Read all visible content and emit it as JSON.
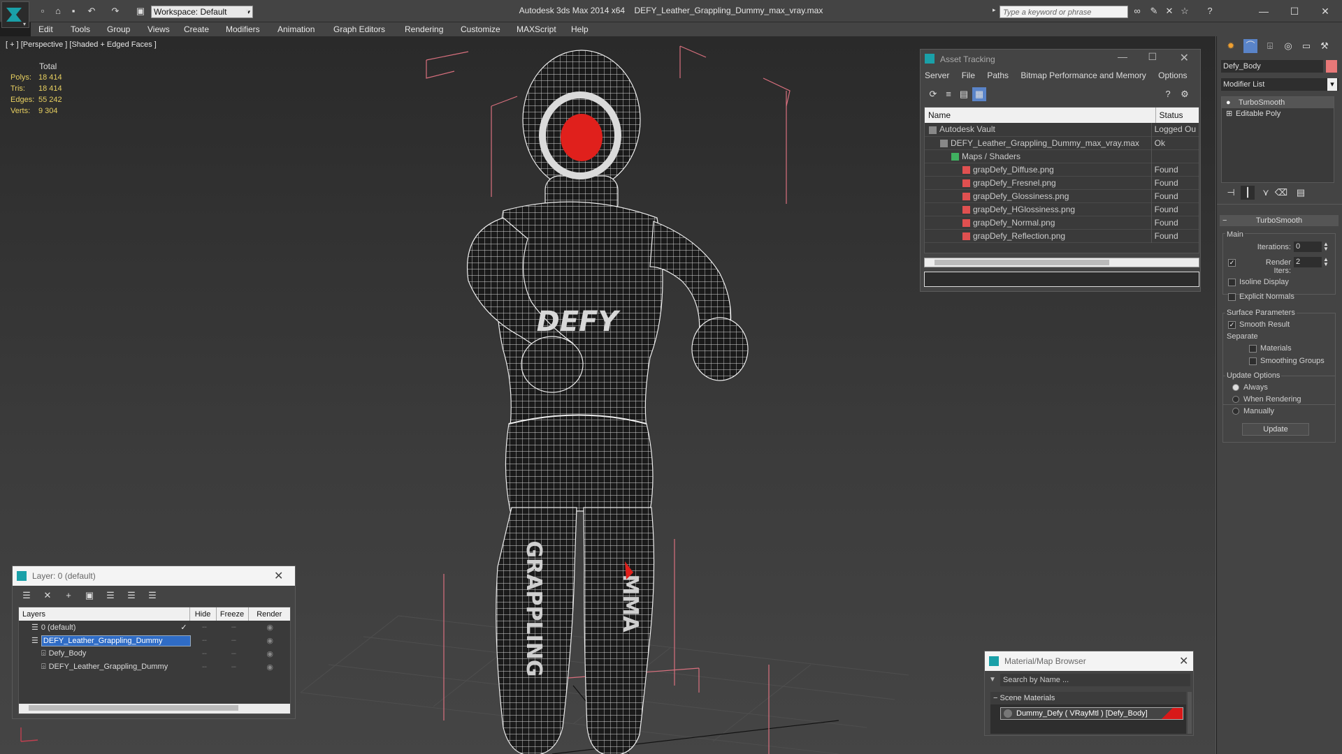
{
  "titlebar": {
    "workspace": "Workspace: Default",
    "app_title": "Autodesk 3ds Max  2014 x64",
    "file_title": "DEFY_Leather_Grappling_Dummy_max_vray.max",
    "search_placeholder": "Type a keyword or phrase"
  },
  "menu": [
    "Edit",
    "Tools",
    "Group",
    "Views",
    "Create",
    "Modifiers",
    "Animation",
    "Graph Editors",
    "Rendering",
    "Customize",
    "MAXScript",
    "Help"
  ],
  "viewport": {
    "label": "[ + ] [Perspective ] [Shaded + Edged Faces ]",
    "stats_header": "Total",
    "stats": [
      {
        "label": "Polys:",
        "value": "18 414"
      },
      {
        "label": "Tris:",
        "value": "18 414"
      },
      {
        "label": "Edges:",
        "value": "55 242"
      },
      {
        "label": "Verts:",
        "value": "9 304"
      }
    ],
    "chest_logo": "DEFY",
    "leg_text_left": "GRAPPLING",
    "leg_text_right": "MMA"
  },
  "asset_tracking": {
    "title": "Asset Tracking",
    "menu": [
      "Server",
      "File",
      "Paths",
      "Bitmap Performance and Memory",
      "Options"
    ],
    "col_name": "Name",
    "col_status": "Status",
    "rows": [
      {
        "name": "Autodesk Vault",
        "status": "Logged Ou",
        "indent": 0,
        "icon": "vault-icon"
      },
      {
        "name": "DEFY_Leather_Grappling_Dummy_max_vray.max",
        "status": "Ok",
        "indent": 1,
        "icon": "max-file-icon"
      },
      {
        "name": "Maps / Shaders",
        "status": "",
        "indent": 2,
        "icon": "maps-icon"
      },
      {
        "name": "grapDefy_Diffuse.png",
        "status": "Found",
        "indent": 3,
        "icon": "png-icon"
      },
      {
        "name": "grapDefy_Fresnel.png",
        "status": "Found",
        "indent": 3,
        "icon": "png-icon"
      },
      {
        "name": "grapDefy_Glossiness.png",
        "status": "Found",
        "indent": 3,
        "icon": "png-icon"
      },
      {
        "name": "grapDefy_HGlossiness.png",
        "status": "Found",
        "indent": 3,
        "icon": "png-icon"
      },
      {
        "name": "grapDefy_Normal.png",
        "status": "Found",
        "indent": 3,
        "icon": "png-icon"
      },
      {
        "name": "grapDefy_Reflection.png",
        "status": "Found",
        "indent": 3,
        "icon": "png-icon"
      }
    ]
  },
  "layer_panel": {
    "title": "Layer: 0 (default)",
    "help": "?",
    "col_layers": "Layers",
    "col_hide": "Hide",
    "col_freeze": "Freeze",
    "col_render": "Render",
    "rows": [
      {
        "name": "0 (default)",
        "indent": 1,
        "selected": false,
        "active": true
      },
      {
        "name": "DEFY_Leather_Grappling_Dummy",
        "indent": 1,
        "selected": true,
        "active": false
      },
      {
        "name": "Defy_Body",
        "indent": 2,
        "selected": false,
        "active": false
      },
      {
        "name": "DEFY_Leather_Grappling_Dummy",
        "indent": 2,
        "selected": false,
        "active": false
      }
    ]
  },
  "material_browser": {
    "title": "Material/Map Browser",
    "search_placeholder": "Search by Name ...",
    "section": "Scene Materials",
    "item": "Dummy_Defy  ( VRayMtl )  [Defy_Body]"
  },
  "command_panel": {
    "object_name": "Defy_Body",
    "object_color": "#e87878",
    "modifier_list": "Modifier List",
    "stack": [
      "TurboSmooth",
      "Editable Poly"
    ],
    "rollout_title": "TurboSmooth",
    "main_label": "Main",
    "iterations_label": "Iterations:",
    "iterations_value": "0",
    "render_iters_label": "Render Iters:",
    "render_iters_value": "2",
    "render_iters_checked": true,
    "isoline_label": "Isoline Display",
    "explicit_normals_label": "Explicit Normals",
    "surface_params_label": "Surface Parameters",
    "smooth_result_label": "Smooth Result",
    "separate_label": "Separate",
    "materials_label": "Materials",
    "smoothing_groups_label": "Smoothing Groups",
    "update_options_label": "Update Options",
    "always_label": "Always",
    "when_rendering_label": "When Rendering",
    "manually_label": "Manually",
    "update_button": "Update"
  }
}
